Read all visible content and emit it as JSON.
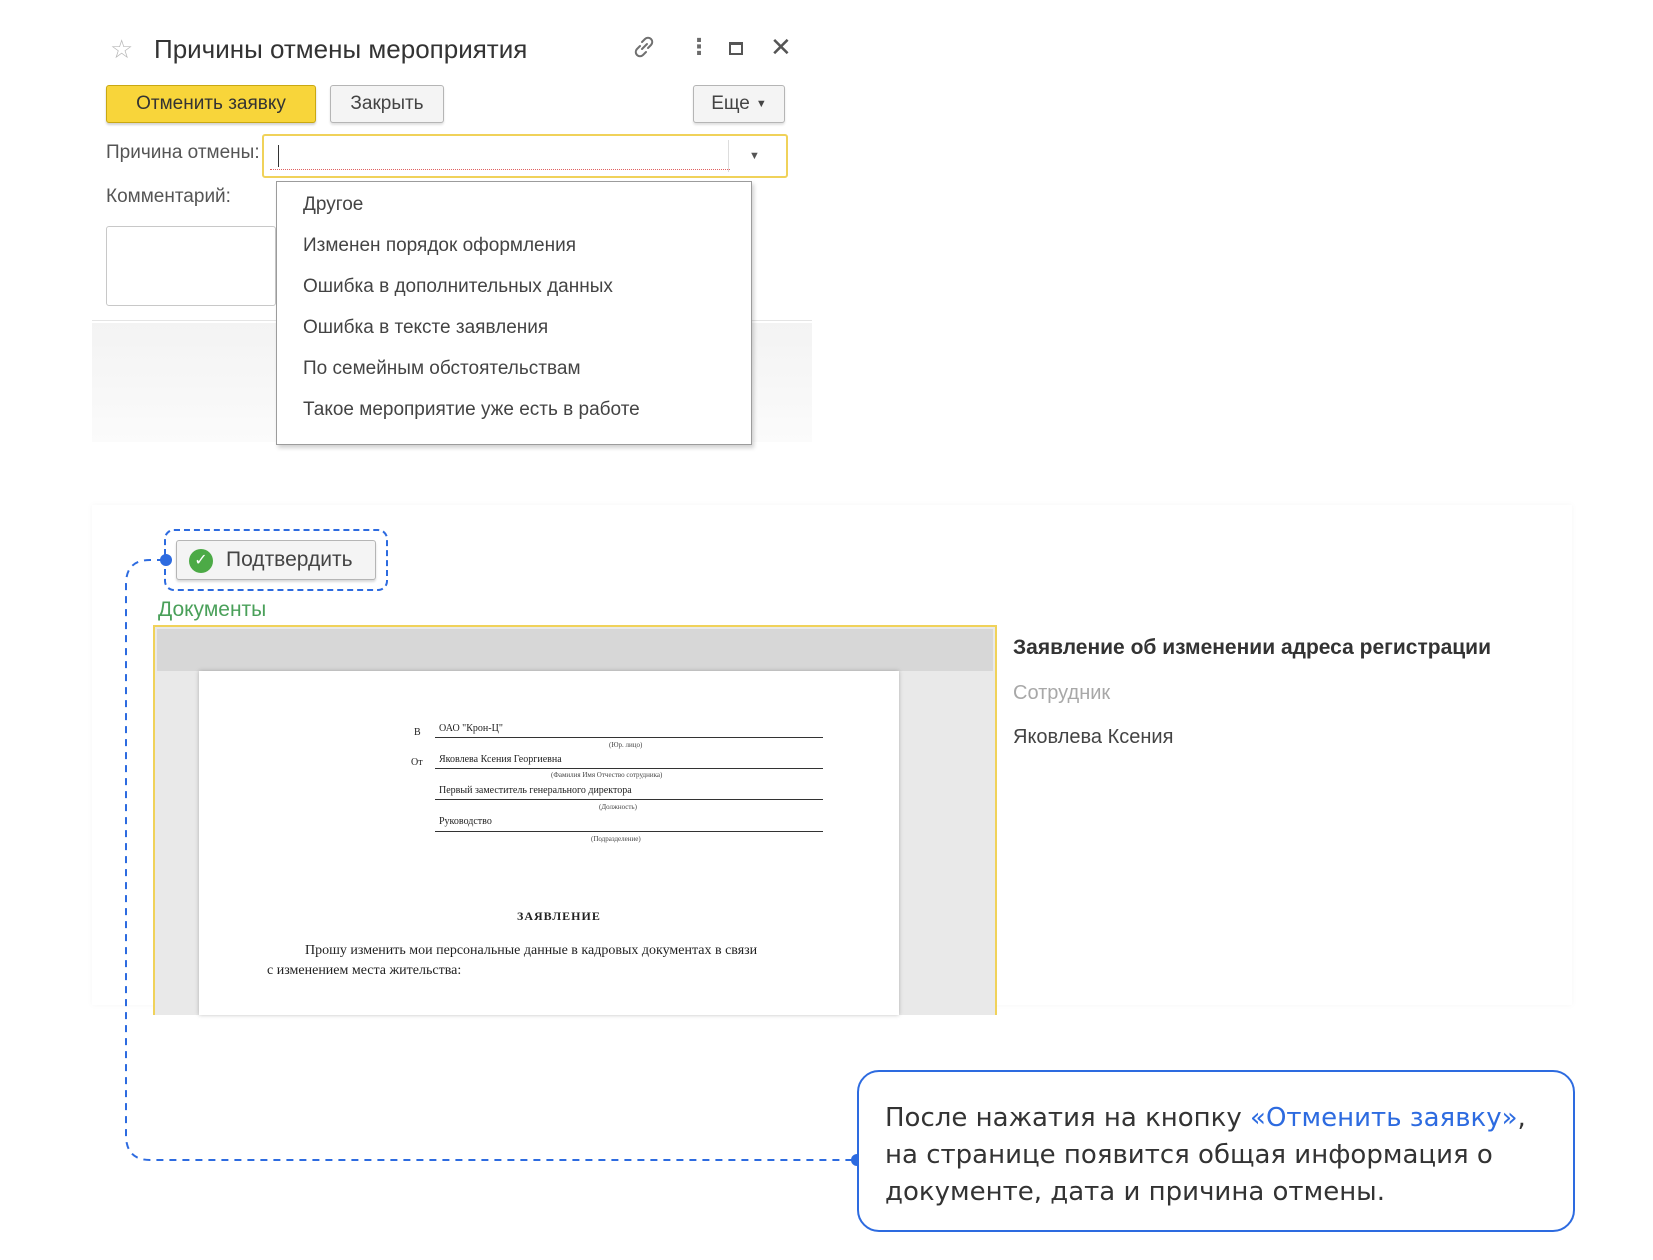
{
  "dialog": {
    "title": "Причины отмены мероприятия",
    "icons": {
      "favorite": "star-icon",
      "link": "link-icon",
      "menu": "kebab-icon",
      "maximize": "maximize-icon",
      "close": "close-icon"
    },
    "star_glyph": "☆",
    "link_glyph": "🔗",
    "menu_glyph": "⋮",
    "close_glyph": "✕",
    "buttons": {
      "cancel_request": "Отменить заявку",
      "close": "Закрыть",
      "more": "Еще"
    },
    "reason_label": "Причина отмены:",
    "comment_label": "Комментарий:",
    "reason_value": "",
    "dropdown_options": [
      "Другое",
      "Изменен порядок оформления",
      "Ошибка в дополнительных данных",
      "Ошибка в тексте заявления",
      "По семейным обстоятельствам",
      "Такое мероприятие уже есть в работе"
    ]
  },
  "lower": {
    "confirm_button": "Подтвердить",
    "documents_label": "Документы",
    "info_title": "Заявление об изменении адреса регистрации",
    "employee_label": "Сотрудник",
    "employee_name": "Яковлева Ксения"
  },
  "document_preview": {
    "to_prefix": "В",
    "to_value": "ОАО \"Крон-Ц\"",
    "to_caption": "(Юр. лицо)",
    "from_prefix": "От",
    "from_value": "Яковлева Ксения Георгиевна",
    "from_caption": "(Фамилия Имя Отчество сотрудника)",
    "position_value": "Первый заместитель генерального директора",
    "position_caption": "(Должность)",
    "department_value": "Руководство",
    "department_caption": "(Подразделение)",
    "heading": "ЗАЯВЛЕНИЕ",
    "body_line1": "Прошу изменить мои персональные данные в кадровых документах в связи",
    "body_line2": "с изменением места жительства:"
  },
  "callout": {
    "text_before": "После нажатия на кнопку ",
    "link_text": "«Отменить заявку»",
    "text_after": ", на странице появится общая информация о документе, дата и причина отмены."
  },
  "colors": {
    "primary_button": "#f8d53a",
    "accent_blue": "#2d6be0",
    "documents_green": "#4aa05a",
    "focus_yellow": "#f0d25a",
    "check_green": "#4caa46"
  }
}
